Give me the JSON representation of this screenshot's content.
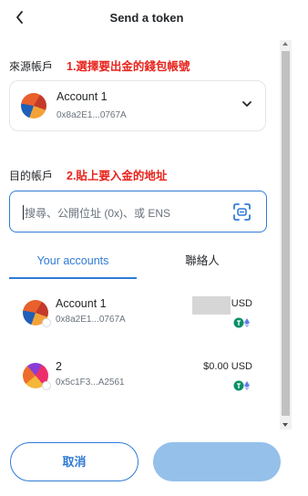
{
  "header": {
    "title": "Send a token",
    "back_icon": "chevron-left-icon"
  },
  "from": {
    "label": "來源帳戶",
    "annotation": "1.選擇要出金的錢包帳號",
    "account": {
      "name": "Account 1",
      "address": "0x8a2E1...0767A"
    }
  },
  "to": {
    "label": "目的帳戶",
    "annotation": "2.貼上要入金的地址",
    "placeholder": "搜尋、公開位址 (0x)、或 ENS"
  },
  "tabs": [
    {
      "label": "Your accounts",
      "active": true
    },
    {
      "label": "聯絡人",
      "active": false
    }
  ],
  "accounts": [
    {
      "name": "Account 1",
      "address": "0x8a2E1...0767A",
      "balance": "",
      "currency": "USD"
    },
    {
      "name": "2",
      "address": "0x5c1F3...A2561",
      "balance": "$0.00",
      "currency": "USD"
    }
  ],
  "buttons": {
    "cancel": "取消",
    "next": ""
  },
  "colors": {
    "accent": "#2f7bd6",
    "annotation": "#e8231c",
    "disabled_button": "#94c0ea"
  }
}
